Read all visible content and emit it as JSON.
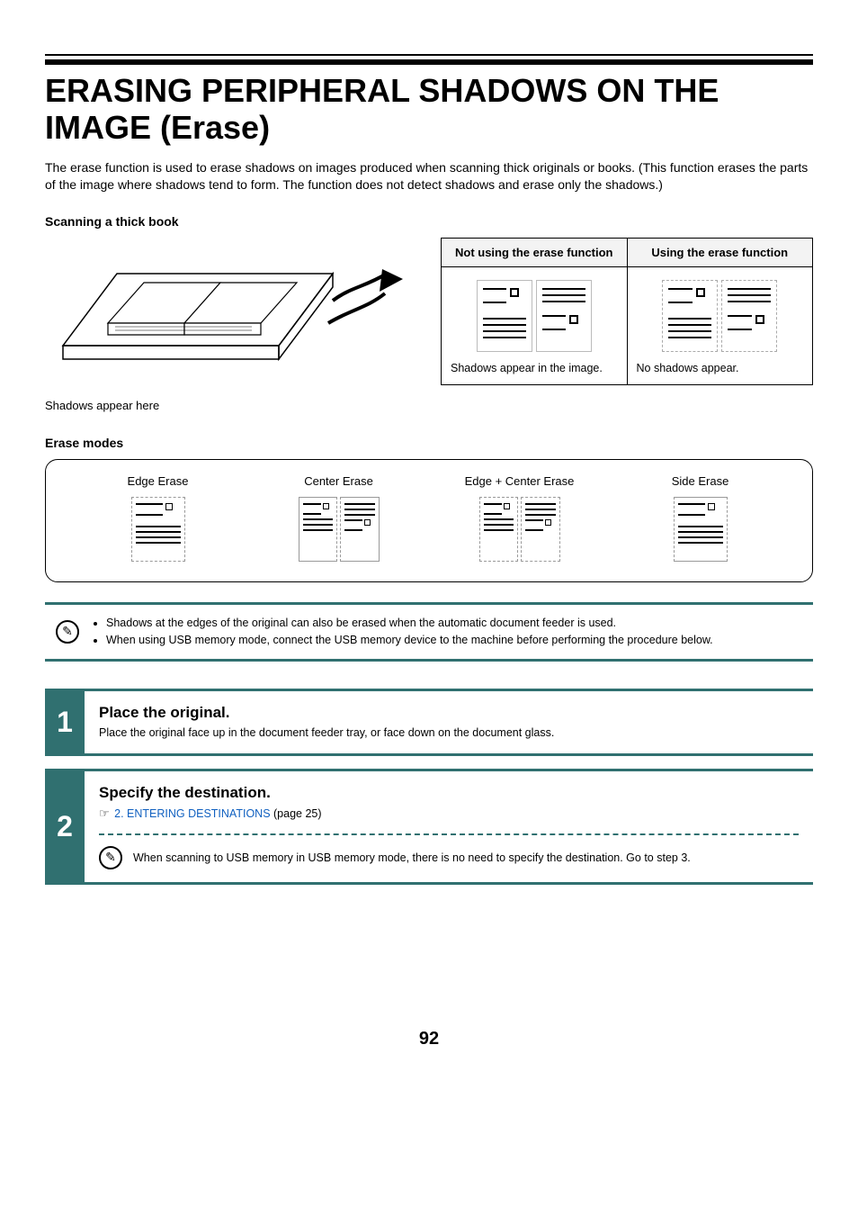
{
  "title": "ERASING PERIPHERAL SHADOWS ON THE IMAGE (Erase)",
  "intro": "The erase function is used to erase shadows on images produced when scanning thick originals or books. (This function erases the parts of the image where shadows tend to form. The function does not detect shadows and erase only the shadows.)",
  "scanning_head": "Scanning a thick book",
  "shadows_caption": "Shadows appear here",
  "compare": {
    "not_using_head": "Not using the erase function",
    "using_head": "Using the erase function",
    "not_using_caption": "Shadows appear in the image.",
    "using_caption": "No shadows appear."
  },
  "erase_modes_head": "Erase modes",
  "modes": {
    "edge": "Edge Erase",
    "center": "Center Erase",
    "edge_center": "Edge + Center Erase",
    "side": "Side Erase"
  },
  "notes": {
    "n1": "Shadows at the edges of the original can also be erased when the automatic document feeder is used.",
    "n2": "When using USB memory mode, connect the USB memory device to the machine before performing the procedure below."
  },
  "steps": {
    "s1": {
      "num": "1",
      "title": "Place the original.",
      "text": "Place the original face up in the document feeder tray, or face down on the document glass."
    },
    "s2": {
      "num": "2",
      "title": "Specify the destination.",
      "link_text": "2. ENTERING DESTINATIONS",
      "page_ref": " (page 25)",
      "note": "When scanning to USB memory in USB memory mode, there is no need to specify the destination. Go to step 3."
    }
  },
  "page_number": "92",
  "pointer_glyph": "☞",
  "pencil_glyph": "✎"
}
